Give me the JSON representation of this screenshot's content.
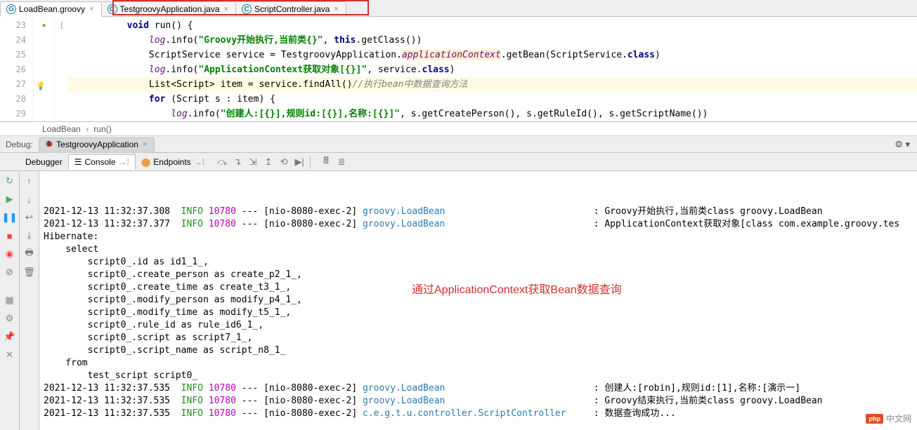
{
  "tabs": [
    {
      "label": "LoadBean.groovy",
      "icon": "G",
      "active": true
    },
    {
      "label": "TestgroovyApplication.java",
      "icon": "C",
      "active": false
    },
    {
      "label": "ScriptController.java",
      "icon": "C",
      "active": false
    }
  ],
  "editor": {
    "lines": [
      {
        "num": "23",
        "indent": 2,
        "tokens": [
          {
            "t": "kw",
            "v": "void"
          },
          {
            "t": "p",
            "v": " run() {"
          }
        ],
        "hl": false,
        "mark": true,
        "collapse": "["
      },
      {
        "num": "24",
        "indent": 3,
        "tokens": [
          {
            "t": "fld",
            "v": "log"
          },
          {
            "t": "p",
            "v": ".info("
          },
          {
            "t": "str",
            "v": "\"Groovy开始执行,当前类{}\""
          },
          {
            "t": "p",
            "v": ", "
          },
          {
            "t": "kw",
            "v": "this"
          },
          {
            "t": "p",
            "v": ".getClass())"
          }
        ],
        "hl": false
      },
      {
        "num": "25",
        "indent": 3,
        "tokens": [
          {
            "t": "p",
            "v": "ScriptService service = TestgroovyApplication."
          },
          {
            "t": "ctx",
            "v": "applicationContext"
          },
          {
            "t": "p",
            "v": ".getBean(ScriptService."
          },
          {
            "t": "kw",
            "v": "class"
          },
          {
            "t": "p",
            "v": ")"
          }
        ],
        "hl": false
      },
      {
        "num": "26",
        "indent": 3,
        "tokens": [
          {
            "t": "fld",
            "v": "log"
          },
          {
            "t": "p",
            "v": ".info("
          },
          {
            "t": "str",
            "v": "\"ApplicationContext获取对象[{}]\""
          },
          {
            "t": "p",
            "v": ", service."
          },
          {
            "t": "kw",
            "v": "class"
          },
          {
            "t": "p",
            "v": ")"
          }
        ],
        "hl": false
      },
      {
        "num": "27",
        "indent": 3,
        "tokens": [
          {
            "t": "p",
            "v": "List<Script> item = service.findAll()"
          },
          {
            "t": "cmt",
            "v": "//执行bean中数据查询方法"
          }
        ],
        "hl": true,
        "bulb": true
      },
      {
        "num": "28",
        "indent": 3,
        "tokens": [
          {
            "t": "kw",
            "v": "for"
          },
          {
            "t": "p",
            "v": " (Script s : item) {"
          }
        ],
        "hl": false
      },
      {
        "num": "29",
        "indent": 4,
        "tokens": [
          {
            "t": "fld",
            "v": "log"
          },
          {
            "t": "p",
            "v": ".info("
          },
          {
            "t": "str",
            "v": "\"创建人:[{}],规则id:[{}],名称:[{}]\""
          },
          {
            "t": "p",
            "v": ", s.getCreatePerson(), s.getRuleId(), s.getScriptName())"
          }
        ],
        "hl": false
      }
    ]
  },
  "breadcrumb": {
    "parts": [
      "LoadBean",
      "run()"
    ]
  },
  "debug": {
    "label": "Debug:",
    "run_config": "TestgroovyApplication",
    "tool_tabs": [
      "Debugger",
      "Console",
      "Endpoints"
    ],
    "active_tool_tab": 1
  },
  "console": {
    "lines": [
      {
        "ts": "2021-12-13 11:32:37.308",
        "level": "INFO",
        "pid": "10780",
        "thread": "[nio-8080-exec-2]",
        "logger": "groovy.LoadBean",
        "msg": ": Groovy开始执行,当前类class groovy.LoadBean"
      },
      {
        "ts": "2021-12-13 11:32:37.377",
        "level": "INFO",
        "pid": "10780",
        "thread": "[nio-8080-exec-2]",
        "logger": "groovy.LoadBean",
        "msg": ": ApplicationContext获取对象[class com.example.groovy.tes"
      },
      {
        "raw": "Hibernate:"
      },
      {
        "raw": "    select"
      },
      {
        "raw": "        script0_.id as id1_1_,"
      },
      {
        "raw": "        script0_.create_person as create_p2_1_,"
      },
      {
        "raw": "        script0_.create_time as create_t3_1_,"
      },
      {
        "raw": "        script0_.modify_person as modify_p4_1_,"
      },
      {
        "raw": "        script0_.modify_time as modify_t5_1_,"
      },
      {
        "raw": "        script0_.rule_id as rule_id6_1_,"
      },
      {
        "raw": "        script0_.script as script7_1_,"
      },
      {
        "raw": "        script0_.script_name as script_n8_1_"
      },
      {
        "raw": "    from"
      },
      {
        "raw": "        test_script script0_"
      },
      {
        "ts": "2021-12-13 11:32:37.535",
        "level": "INFO",
        "pid": "10780",
        "thread": "[nio-8080-exec-2]",
        "logger": "groovy.LoadBean",
        "msg": ": 创建人:[robin],规则id:[1],名称:[演示一]"
      },
      {
        "ts": "2021-12-13 11:32:37.535",
        "level": "INFO",
        "pid": "10780",
        "thread": "[nio-8080-exec-2]",
        "logger": "groovy.LoadBean",
        "msg": ": Groovy结束执行,当前类class groovy.LoadBean"
      },
      {
        "ts": "2021-12-13 11:32:37.535",
        "level": "INFO",
        "pid": "10780",
        "thread": "[nio-8080-exec-2]",
        "logger": "c.e.g.t.u.controller.ScriptController",
        "msg": ": 数据查询成功..."
      }
    ],
    "overlay": "通过ApplicationContext获取Bean数据查询"
  },
  "watermark": {
    "logo": "php",
    "text": "中文网"
  }
}
